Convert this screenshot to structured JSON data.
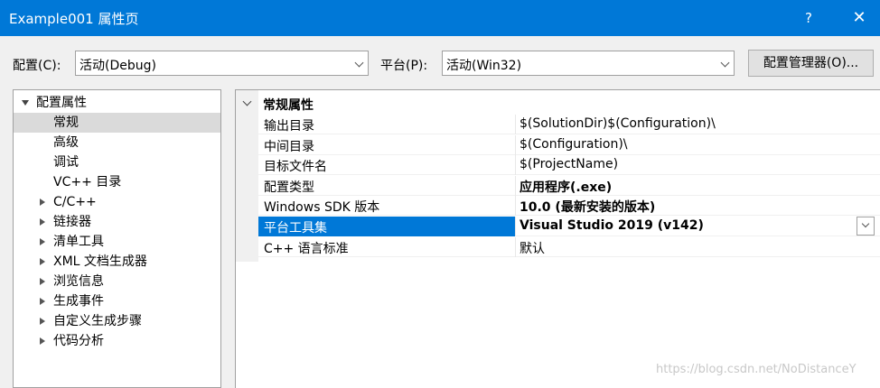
{
  "window": {
    "title": "Example001 属性页",
    "help_label": "?",
    "close_label": "✕"
  },
  "config": {
    "label": "配置(C):",
    "value": "活动(Debug)"
  },
  "platform": {
    "label": "平台(P):",
    "value": "活动(Win32)"
  },
  "config_manager_button": "配置管理器(O)...",
  "tree": {
    "root": "配置属性",
    "items": [
      {
        "label": "常规",
        "selected": true,
        "expandable": false
      },
      {
        "label": "高级",
        "expandable": false
      },
      {
        "label": "调试",
        "expandable": false
      },
      {
        "label": "VC++ 目录",
        "expandable": false
      },
      {
        "label": "C/C++",
        "expandable": true
      },
      {
        "label": "链接器",
        "expandable": true
      },
      {
        "label": "清单工具",
        "expandable": true
      },
      {
        "label": "XML 文档生成器",
        "expandable": true
      },
      {
        "label": "浏览信息",
        "expandable": true
      },
      {
        "label": "生成事件",
        "expandable": true
      },
      {
        "label": "自定义生成步骤",
        "expandable": true
      },
      {
        "label": "代码分析",
        "expandable": true
      }
    ]
  },
  "grid": {
    "category": "常规属性",
    "rows": [
      {
        "name": "输出目录",
        "value": "$(SolutionDir)$(Configuration)\\"
      },
      {
        "name": "中间目录",
        "value": "$(Configuration)\\"
      },
      {
        "name": "目标文件名",
        "value": "$(ProjectName)"
      },
      {
        "name": "配置类型",
        "value": "应用程序(.exe)",
        "bold": true
      },
      {
        "name": "Windows SDK 版本",
        "value": "10.0 (最新安装的版本)",
        "bold": true
      },
      {
        "name": "平台工具集",
        "value": "Visual Studio 2019 (v142)",
        "bold": true,
        "selected": true
      },
      {
        "name": "C++ 语言标准",
        "value": "默认"
      }
    ]
  },
  "watermark": "https://blog.csdn.net/NoDistanceY"
}
